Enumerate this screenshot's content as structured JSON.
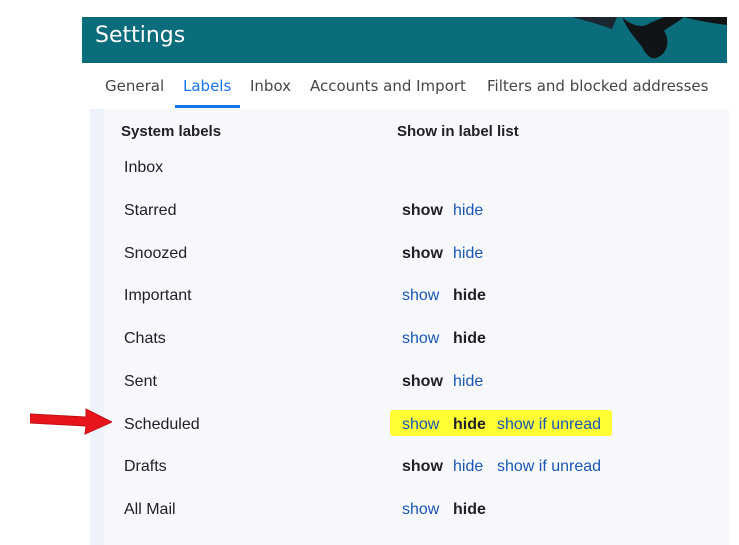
{
  "header": {
    "title": "Settings"
  },
  "tabs": [
    {
      "label": "General"
    },
    {
      "label": "Labels"
    },
    {
      "label": "Inbox"
    },
    {
      "label": "Accounts and Import"
    },
    {
      "label": "Filters and blocked addresses"
    }
  ],
  "active_tab": "Labels",
  "columns": {
    "system_labels": "System labels",
    "show_in_list": "Show in label list"
  },
  "rows": [
    {
      "label": "Inbox"
    },
    {
      "label": "Starred",
      "show": "show",
      "hide": "hide",
      "selected": "show"
    },
    {
      "label": "Snoozed",
      "show": "show",
      "hide": "hide",
      "selected": "show"
    },
    {
      "label": "Important",
      "show": "show",
      "hide": "hide",
      "selected": "hide"
    },
    {
      "label": "Chats",
      "show": "show",
      "hide": "hide",
      "selected": "hide"
    },
    {
      "label": "Sent",
      "show": "show",
      "hide": "hide",
      "selected": "show"
    },
    {
      "label": "Scheduled",
      "show": "show",
      "hide": "hide",
      "show_if_unread": "show if unread",
      "selected": "hide",
      "highlighted": true
    },
    {
      "label": "Drafts",
      "show": "show",
      "hide": "hide",
      "show_if_unread": "show if unread",
      "selected": "show"
    },
    {
      "label": "All Mail",
      "show": "show",
      "hide": "hide",
      "selected": "hide"
    }
  ],
  "colors": {
    "header_bg": "#0b6c7c",
    "link": "#1a57b4",
    "active_tab": "#1a73e8",
    "highlight": "#ffff33",
    "arrow": "#e8141c"
  },
  "annotation": {
    "arrow_points_to": "Scheduled"
  }
}
